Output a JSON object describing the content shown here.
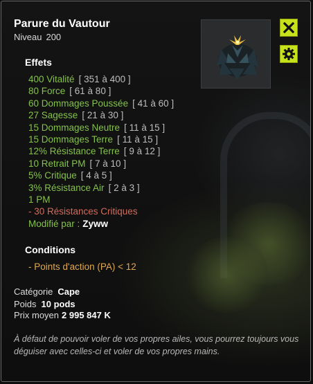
{
  "item": {
    "name": "Parure du Vautour",
    "level_label": "Niveau",
    "level_value": "200"
  },
  "effects_title": "Effets",
  "effects": [
    {
      "text": "400 Vitalité",
      "range": "[ 351 à 400 ]",
      "kind": "positive"
    },
    {
      "text": "80 Force",
      "range": "[ 61 à 80 ]",
      "kind": "positive"
    },
    {
      "text": "60 Dommages Poussée",
      "range": "[ 41 à 60 ]",
      "kind": "positive"
    },
    {
      "text": "27 Sagesse",
      "range": "[ 21 à 30 ]",
      "kind": "positive"
    },
    {
      "text": "15 Dommages Neutre",
      "range": "[ 11 à 15 ]",
      "kind": "positive"
    },
    {
      "text": "15 Dommages Terre",
      "range": "[ 11 à 15 ]",
      "kind": "positive"
    },
    {
      "text": "12% Résistance Terre",
      "range": "[ 9 à 12 ]",
      "kind": "positive"
    },
    {
      "text": "10 Retrait PM",
      "range": "[ 7 à 10 ]",
      "kind": "positive"
    },
    {
      "text": "5% Critique",
      "range": "[ 4 à 5 ]",
      "kind": "positive"
    },
    {
      "text": "3% Résistance Air",
      "range": "[ 2 à 3 ]",
      "kind": "positive"
    },
    {
      "text": "1 PM",
      "range": "",
      "kind": "positive"
    },
    {
      "text": "- 30 Résistances Critiques",
      "range": "",
      "kind": "negative"
    }
  ],
  "modified_by": {
    "label": "Modifié par :",
    "user": "Zyww"
  },
  "conditions_title": "Conditions",
  "conditions": [
    "- Points d'action (PA) < 12"
  ],
  "meta": {
    "category_label": "Catégorie",
    "category_value": "Cape",
    "weight_label": "Poids",
    "weight_value": "10 pods",
    "price_label": "Prix moyen",
    "price_value": "2 995 847 K"
  },
  "description": "À défaut de pouvoir voler de vos propres ailes, vous pourrez toujours vous déguiser avec celles-ci et voler de vos propres mains.",
  "icons": {
    "close": "close-icon",
    "settings": "gear-icon",
    "item": "item-image"
  },
  "colors": {
    "accent": "#c7e21a",
    "positive": "#84c24b",
    "negative": "#d36b5c",
    "condition": "#e0a850"
  }
}
